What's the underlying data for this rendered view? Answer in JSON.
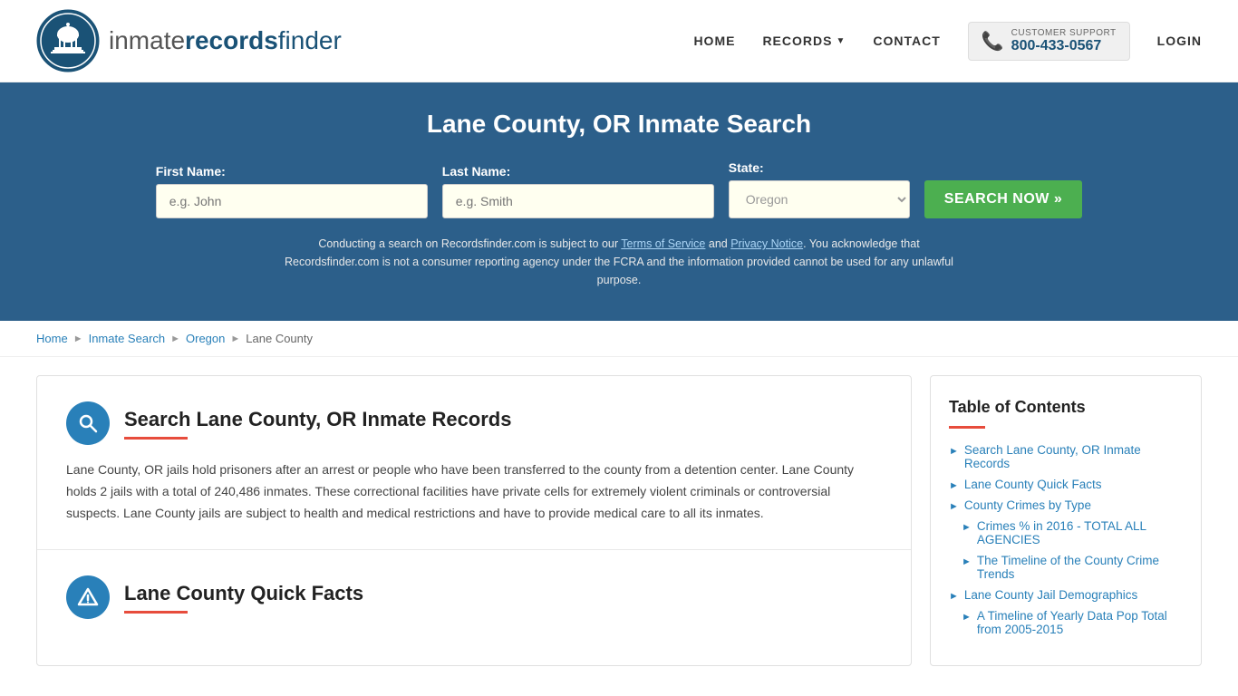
{
  "header": {
    "logo_text_inmate": "inmate",
    "logo_text_records": "records",
    "logo_text_finder": "finder",
    "nav": {
      "home": "HOME",
      "records": "RECORDS",
      "contact": "CONTACT",
      "login": "LOGIN",
      "support_label": "CUSTOMER SUPPORT",
      "support_number": "800-433-0567"
    }
  },
  "hero": {
    "title": "Lane County, OR Inmate Search",
    "first_name_label": "First Name:",
    "first_name_placeholder": "e.g. John",
    "last_name_label": "Last Name:",
    "last_name_placeholder": "e.g. Smith",
    "state_label": "State:",
    "state_value": "Oregon",
    "search_button": "SEARCH NOW »",
    "disclaimer": "Conducting a search on Recordsfinder.com is subject to our Terms of Service and Privacy Notice. You acknowledge that Recordsfinder.com is not a consumer reporting agency under the FCRA and the information provided cannot be used for any unlawful purpose."
  },
  "breadcrumb": {
    "home": "Home",
    "inmate_search": "Inmate Search",
    "state": "Oregon",
    "county": "Lane County"
  },
  "main": {
    "section1": {
      "title": "Search Lane County, OR Inmate Records",
      "body": "Lane County, OR jails hold prisoners after an arrest or people who have been transferred to the county from a detention center. Lane County holds 2 jails with a total of 240,486 inmates. These correctional facilities have private cells for extremely violent criminals or controversial suspects. Lane County jails are subject to health and medical restrictions and have to provide medical care to all its inmates."
    },
    "section2": {
      "title": "Lane County Quick Facts"
    }
  },
  "toc": {
    "title": "Table of Contents",
    "items": [
      {
        "label": "Search Lane County, OR Inmate Records",
        "sub": false
      },
      {
        "label": "Lane County Quick Facts",
        "sub": false
      },
      {
        "label": "County Crimes by Type",
        "sub": false
      },
      {
        "label": "Crimes % in 2016 - TOTAL ALL AGENCIES",
        "sub": true
      },
      {
        "label": "The Timeline of the County Crime Trends",
        "sub": true
      },
      {
        "label": "Lane County Jail Demographics",
        "sub": false
      },
      {
        "label": "A Timeline of Yearly Data Pop Total from 2005-2015",
        "sub": true
      }
    ]
  }
}
